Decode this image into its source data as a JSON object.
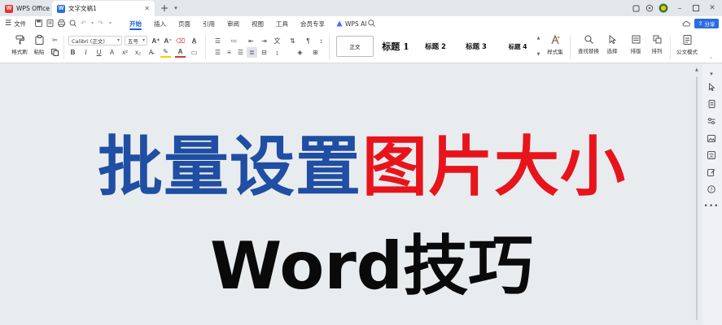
{
  "titlebar": {
    "app_tab": "WPS Office",
    "doc_tab": "文字文稿1",
    "new_tab_symbol": "+"
  },
  "menubar": {
    "file_label": "文件",
    "menu_items": [
      "开始",
      "插入",
      "页面",
      "引用",
      "审阅",
      "视图",
      "工具",
      "会员专享"
    ],
    "active_menu": "开始",
    "ai_label": "WPS AI",
    "share_label": "分享"
  },
  "ribbon": {
    "format_painter": "格式刷",
    "paste": "粘贴",
    "font_name": "Calibri (正文)",
    "font_size": "五号",
    "styles": {
      "normal": "正文",
      "heading1": "标题 1",
      "heading2": "标题 2",
      "heading3": "标题 3",
      "heading4": "标题 4"
    },
    "style_set": "样式集",
    "find_replace": "查找替换",
    "select": "选择",
    "sort": "排版",
    "arrange": "排列",
    "formula": "公文模式"
  },
  "document": {
    "headline_part1": "批量设置",
    "headline_part2": "图片大小",
    "subtitle": "Word技巧"
  },
  "colors": {
    "accent_blue": "#1a5fd0",
    "headline_blue": "#1f4ea3",
    "headline_red": "#e8141b",
    "subtitle_black": "#0a0a0a",
    "wps_red": "#e0332e"
  }
}
